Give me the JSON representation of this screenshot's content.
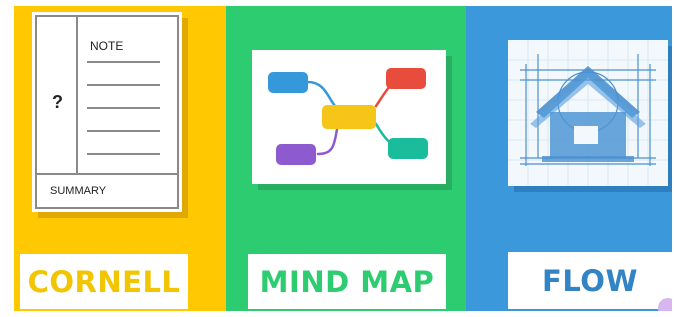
{
  "colors": {
    "cornell_bg": "#ffc800",
    "mind_bg": "#2ecc71",
    "flow_bg": "#3a98db",
    "cornell_text": "#f2c500",
    "mind_text": "#2ecc71",
    "flow_text": "#3384c4",
    "line_gray": "#8a8a8a"
  },
  "panels": {
    "cornell": {
      "label": "CORNELL",
      "note_label": "NOTE",
      "cue_label": "?",
      "summary_label": "SUMMARY"
    },
    "mind_map": {
      "label": "MIND MAP",
      "node_colors": [
        "#3498db",
        "#f5c518",
        "#e74c3c",
        "#1abc9c",
        "#8e5ad0"
      ]
    },
    "flow": {
      "label": "FLOW",
      "icon": "house-blueprint-icon"
    }
  }
}
